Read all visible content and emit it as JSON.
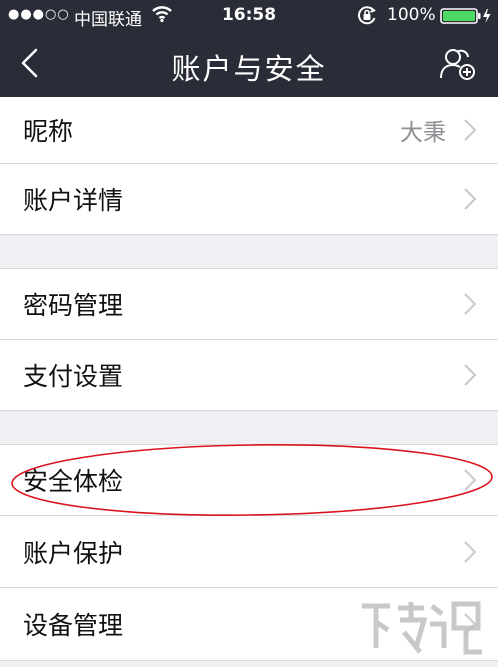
{
  "status_bar": {
    "signal": "●●●○○",
    "carrier": "中国联通",
    "time": "16:58",
    "battery_percent": "100%"
  },
  "nav": {
    "title": "账户与安全"
  },
  "sections": [
    {
      "items": [
        {
          "label": "昵称",
          "value": "大秉"
        },
        {
          "label": "账户详情"
        }
      ]
    },
    {
      "items": [
        {
          "label": "密码管理"
        },
        {
          "label": "支付设置"
        }
      ]
    },
    {
      "items": [
        {
          "label": "安全体检"
        },
        {
          "label": "账户保护"
        },
        {
          "label": "设备管理"
        }
      ]
    }
  ],
  "colors": {
    "header_bg": "#2a2d37",
    "page_bg": "#efeff4",
    "annotation": "#d9141e",
    "battery": "#4cd964"
  },
  "icons": [
    "wifi-icon",
    "orientation-lock-icon",
    "battery-icon",
    "back-chevron-icon",
    "contacts-icon",
    "chevron-right-icon"
  ]
}
